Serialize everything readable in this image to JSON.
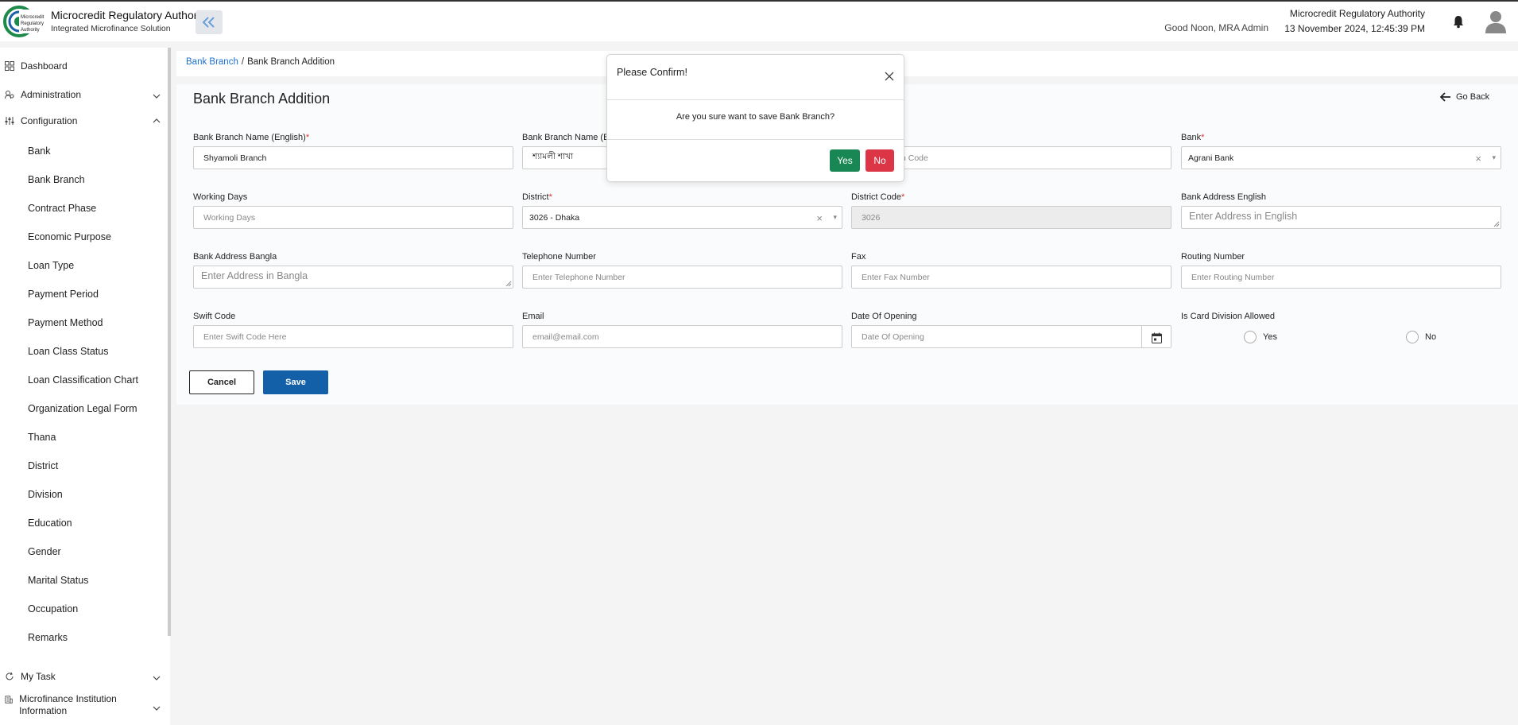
{
  "header": {
    "logo_text": "Microcredit Regulatory Authority",
    "title": "Microcredit Regulatory Authority",
    "subtitle": "Integrated Microfinance Solution",
    "greeting": "Good Noon, MRA Admin",
    "org_name": "Microcredit Regulatory Authority",
    "datetime": "13 November 2024, 12:45:39 PM"
  },
  "sidebar": {
    "dashboard": "Dashboard",
    "administration": "Administration",
    "configuration": "Configuration",
    "sub_items": [
      "Bank",
      "Bank Branch",
      "Contract Phase",
      "Economic Purpose",
      "Loan Type",
      "Payment Period",
      "Payment Method",
      "Loan Class Status",
      "Loan Classification Chart",
      "Organization Legal Form",
      "Thana",
      "District",
      "Division",
      "Education",
      "Gender",
      "Marital Status",
      "Occupation",
      "Remarks"
    ],
    "my_task": "My Task",
    "mfi_info": "Microfinance Institution Information"
  },
  "breadcrumb": {
    "parent": "Bank Branch",
    "separator": "/",
    "current": "Bank Branch Addition"
  },
  "page": {
    "title": "Bank Branch Addition",
    "go_back": "Go Back"
  },
  "form": {
    "branch_name_en": {
      "label": "Bank Branch Name (English)",
      "required": "*",
      "value": "Shyamoli Branch"
    },
    "branch_name_bn": {
      "label": "Bank Branch Name (Ba",
      "value": "শ্যামলী শাখা"
    },
    "branch_code": {
      "placeholder": "h Code"
    },
    "bank": {
      "label": "Bank",
      "required": "*",
      "value": "Agrani Bank",
      "clear": "×",
      "caret": "▾"
    },
    "working_days": {
      "label": "Working Days",
      "placeholder": "Working Days"
    },
    "district": {
      "label": "District",
      "required": "*",
      "value": "3026 - Dhaka",
      "clear": "×",
      "caret": "▾"
    },
    "district_code": {
      "label": "District Code",
      "required": "*",
      "value": "3026"
    },
    "address_en": {
      "label": "Bank Address English",
      "placeholder": "Enter Address in English"
    },
    "address_bn": {
      "label": "Bank Address Bangla",
      "placeholder": "Enter Address in Bangla"
    },
    "telephone": {
      "label": "Telephone Number",
      "placeholder": "Enter Telephone Number"
    },
    "fax": {
      "label": "Fax",
      "placeholder": "Enter Fax Number"
    },
    "routing": {
      "label": "Routing Number",
      "placeholder": "Enter Routing Number"
    },
    "swift": {
      "label": "Swift Code",
      "placeholder": "Enter Swift Code Here"
    },
    "email": {
      "label": "Email",
      "placeholder": "email@email.com"
    },
    "date_opening": {
      "label": "Date Of Opening",
      "placeholder": "Date Of Opening"
    },
    "card_division": {
      "label": "Is Card Division Allowed",
      "yes": "Yes",
      "no": "No"
    }
  },
  "buttons": {
    "cancel": "Cancel",
    "save": "Save"
  },
  "modal": {
    "title": "Please Confirm!",
    "message": "Are you sure want to save Bank Branch?",
    "yes": "Yes",
    "no": "No"
  },
  "colors": {
    "primary": "#1460a8",
    "link": "#1a6fd1",
    "yes": "#198754",
    "no": "#dc3545",
    "required": "#dd3333"
  }
}
